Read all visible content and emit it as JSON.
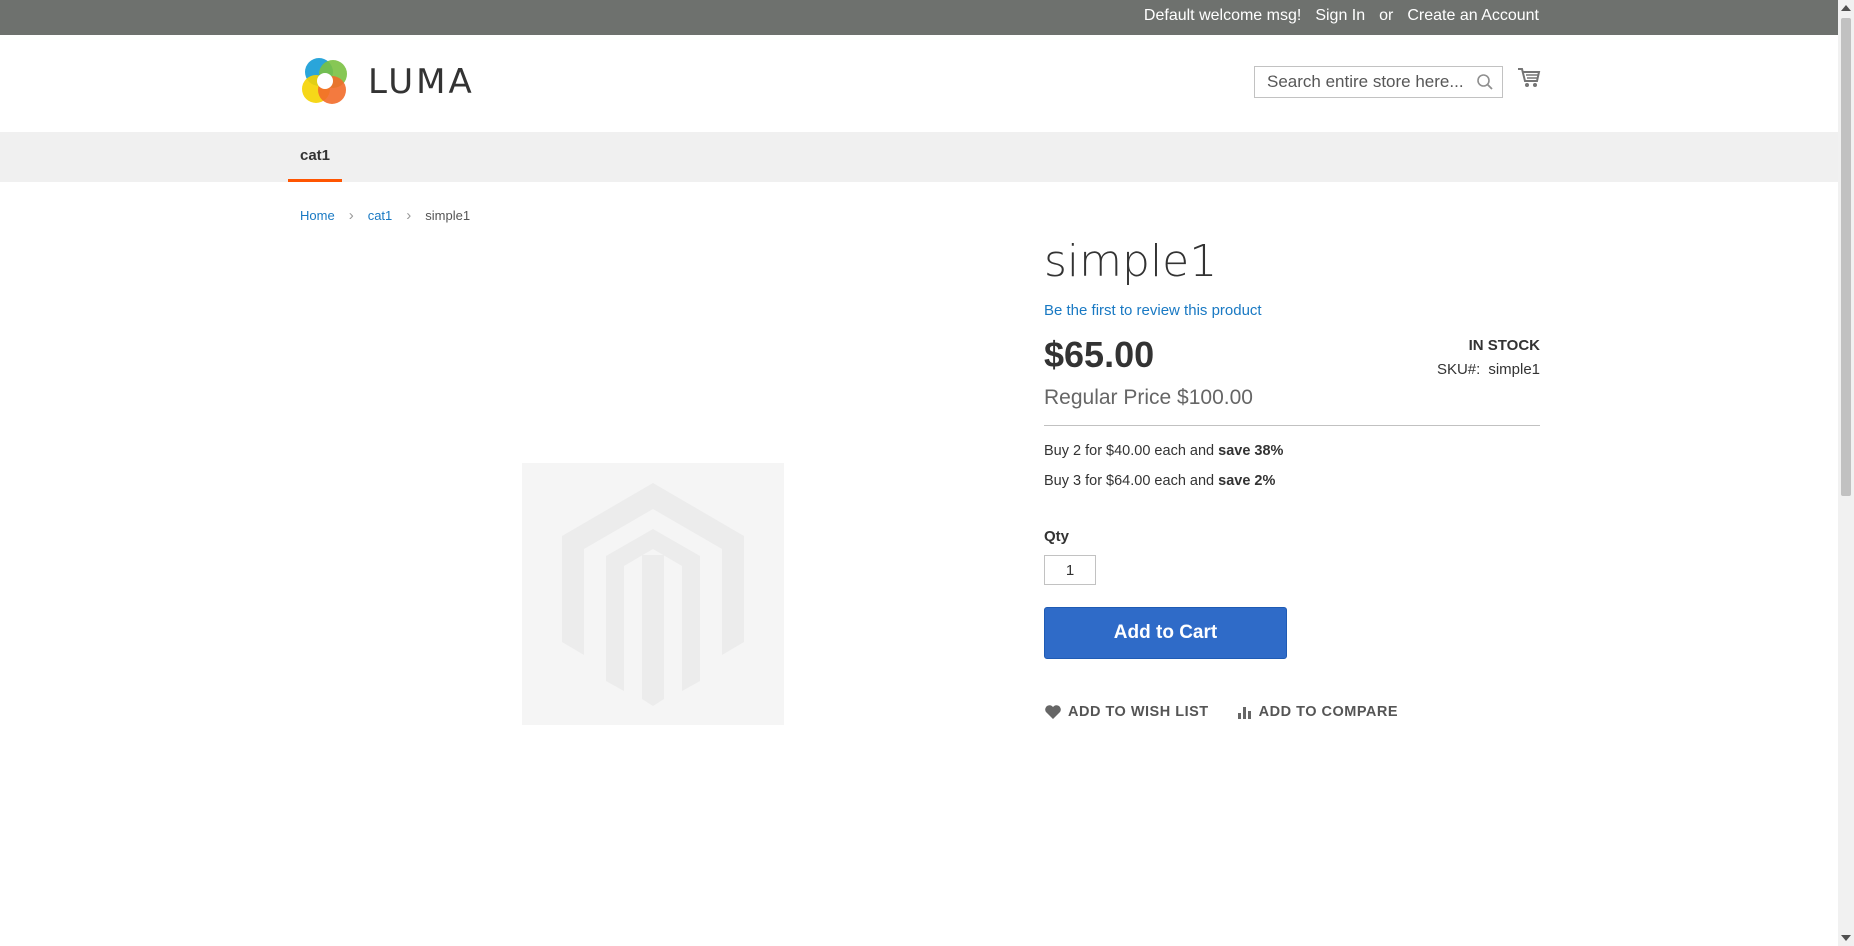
{
  "topbar": {
    "welcome": "Default welcome msg!",
    "sign_in": "Sign In",
    "or": "or",
    "create_account": "Create an Account"
  },
  "header": {
    "logo_text": "LUMA",
    "search_placeholder": "Search entire store here...",
    "search_icon": "search-icon",
    "cart_icon": "cart-icon"
  },
  "nav": {
    "items": [
      {
        "label": "cat1"
      }
    ],
    "active_color": "#ff5501"
  },
  "breadcrumb": {
    "items": [
      {
        "label": "Home"
      },
      {
        "label": "cat1"
      },
      {
        "label": "simple1"
      }
    ]
  },
  "product": {
    "name": "simple1",
    "review_link": "Be the first to review this product",
    "price": "$65.00",
    "regular_price": "Regular Price $100.00",
    "stock": "IN STOCK",
    "sku_label": "SKU#:",
    "sku": "simple1",
    "tiers": [
      {
        "text": "Buy 2 for $40.00 each and ",
        "save": "save 38%"
      },
      {
        "text": "Buy 3 for $64.00 each and ",
        "save": "save 2%"
      }
    ],
    "qty_label": "Qty",
    "qty_value": "1",
    "add_to_cart": "Add to Cart",
    "wishlist": "Add to Wish List",
    "compare": "Add to Compare",
    "image_placeholder_icon": "magento-placeholder-icon"
  },
  "colors": {
    "topbar": "#6e716e",
    "accent_button": "#2f6bc8",
    "link": "#1979c3"
  }
}
